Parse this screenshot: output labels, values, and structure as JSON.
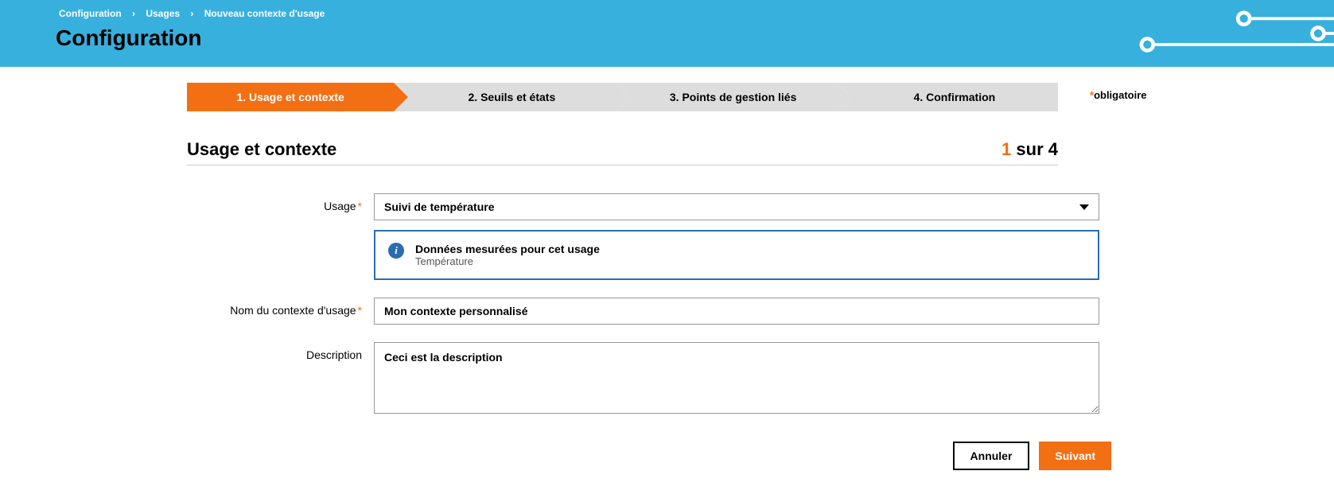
{
  "breadcrumb": {
    "items": [
      "Configuration",
      "Usages",
      "Nouveau contexte d'usage"
    ]
  },
  "page_title": "Configuration",
  "wizard": {
    "steps": [
      {
        "label": "1. Usage et contexte",
        "active": true
      },
      {
        "label": "2. Seuils et états",
        "active": false
      },
      {
        "label": "3. Points de gestion liés",
        "active": false
      },
      {
        "label": "4. Confirmation",
        "active": false
      }
    ]
  },
  "mandatory_label": "obligatoire",
  "section": {
    "title": "Usage et contexte",
    "step_current": "1",
    "step_separator": " sur ",
    "step_total": "4"
  },
  "form": {
    "usage": {
      "label": "Usage",
      "required": true,
      "selected": "Suivi de température"
    },
    "info": {
      "title": "Données mesurées pour cet usage",
      "subtitle": "Température"
    },
    "context_name": {
      "label": "Nom du contexte d'usage",
      "required": true,
      "value": "Mon contexte personnalisé"
    },
    "description": {
      "label": "Description",
      "required": false,
      "value": "Ceci est la description"
    }
  },
  "buttons": {
    "cancel": "Annuler",
    "next": "Suivant"
  }
}
